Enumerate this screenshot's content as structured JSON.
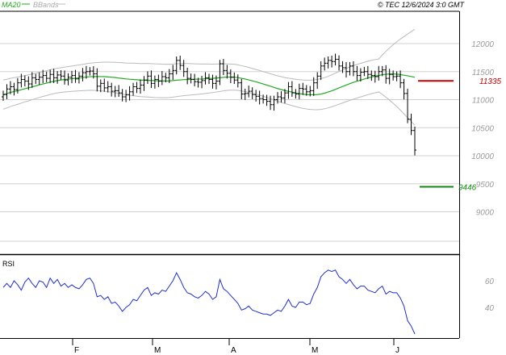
{
  "header": {
    "legend_ma": "MA20",
    "legend_bb": "BBands",
    "stamp": "© TEC 12/6/2024 3:0 GMT"
  },
  "colors": {
    "ma": "#22aa22",
    "bb": "#bbbbbb",
    "price": "#000000",
    "rsi": "#1f2fd0",
    "resistance": "#cc0000",
    "support": "#118811",
    "grid": "#d2d2d2",
    "frame": "#000000",
    "tick": "#999999"
  },
  "chart_data": [
    {
      "type": "candlestick",
      "title": "",
      "y_axis_labels": [
        "12000",
        "11500",
        "11000",
        "10500",
        "10000",
        "9500",
        "9000"
      ],
      "ylim": [
        8500,
        12200
      ],
      "x_axis_labels": [
        "F",
        "M",
        "A",
        "M",
        "J"
      ],
      "levels": [
        {
          "label": "11335",
          "value": 11335,
          "color": "resistance"
        },
        {
          "label": "9446",
          "value": 9446,
          "color": "support"
        }
      ],
      "close": [
        11090,
        11190,
        11230,
        11180,
        11300,
        11360,
        11330,
        11280,
        11390,
        11360,
        11400,
        11430,
        11380,
        11450,
        11390,
        11440,
        11420,
        11350,
        11400,
        11430,
        11370,
        11420,
        11480,
        11500,
        11510,
        11460,
        11240,
        11290,
        11210,
        11230,
        11150,
        11160,
        11120,
        11050,
        11090,
        11140,
        11230,
        11200,
        11260,
        11350,
        11420,
        11290,
        11360,
        11330,
        11410,
        11390,
        11460,
        11520,
        11700,
        11610,
        11500,
        11380,
        11360,
        11320,
        11310,
        11340,
        11390,
        11360,
        11290,
        11330,
        11640,
        11520,
        11470,
        11400,
        11350,
        11300,
        11100,
        11110,
        11150,
        11090,
        11060,
        11020,
        11000,
        10970,
        10910,
        11000,
        11050,
        11030,
        11120,
        11230,
        11120,
        11100,
        11200,
        11190,
        11140,
        11160,
        11300,
        11420,
        11600,
        11650,
        11700,
        11680,
        11720,
        11600,
        11570,
        11500,
        11600,
        11500,
        11430,
        11490,
        11500,
        11450,
        11430,
        11410,
        11500,
        11530,
        11380,
        11450,
        11410,
        11420,
        11300,
        11110,
        10650,
        10450,
        10100
      ],
      "ma20": [
        11090,
        11107,
        11128,
        11145,
        11160,
        11177,
        11195,
        11210,
        11228,
        11245,
        11263,
        11280,
        11295,
        11312,
        11327,
        11340,
        11350,
        11358,
        11366,
        11374,
        11381,
        11388,
        11395,
        11402,
        11409,
        11411,
        11412,
        11411,
        11410,
        11405,
        11400,
        11394,
        11386,
        11378,
        11370,
        11364,
        11360,
        11354,
        11349,
        11347,
        11345,
        11342,
        11338,
        11336,
        11333,
        11333,
        11335,
        11340,
        11347,
        11352,
        11357,
        11360,
        11362,
        11364,
        11366,
        11368,
        11372,
        11377,
        11380,
        11385,
        11391,
        11397,
        11402,
        11402,
        11400,
        11393,
        11380,
        11368,
        11352,
        11335,
        11318,
        11300,
        11280,
        11260,
        11240,
        11218,
        11198,
        11180,
        11162,
        11148,
        11134,
        11120,
        11108,
        11098,
        11090,
        11087,
        11087,
        11090,
        11100,
        11115,
        11135,
        11158,
        11183,
        11210,
        11235,
        11260,
        11285,
        11308,
        11328,
        11348,
        11368,
        11386,
        11404,
        11419,
        11431,
        11445,
        11452,
        11457,
        11458,
        11455,
        11447,
        11436,
        11425,
        11413,
        11398
      ]
    },
    {
      "type": "line",
      "title": "RSI",
      "y_axis_labels": [
        "60",
        "40"
      ],
      "ylim": [
        18,
        82
      ],
      "values": [
        55,
        58,
        55,
        60,
        57,
        53,
        59,
        62,
        58,
        55,
        60,
        59,
        55,
        62,
        58,
        61,
        56,
        58,
        55,
        57,
        55,
        54,
        57,
        61,
        62,
        58,
        48,
        49,
        46,
        48,
        43,
        44,
        41,
        37,
        40,
        42,
        46,
        45,
        49,
        53,
        55,
        49,
        51,
        50,
        53,
        52,
        56,
        60,
        66,
        61,
        55,
        51,
        50,
        48,
        47,
        49,
        52,
        50,
        46,
        48,
        61,
        54,
        52,
        49,
        46,
        43,
        38,
        39,
        41,
        38,
        37,
        36,
        35,
        35,
        34,
        36,
        38,
        37,
        41,
        46,
        41,
        40,
        44,
        44,
        42,
        43,
        50,
        55,
        63,
        66,
        68,
        67,
        68,
        63,
        61,
        58,
        61,
        57,
        54,
        56,
        56,
        53,
        52,
        51,
        54,
        56,
        50,
        52,
        51,
        51,
        47,
        41,
        30,
        26,
        20
      ]
    }
  ]
}
